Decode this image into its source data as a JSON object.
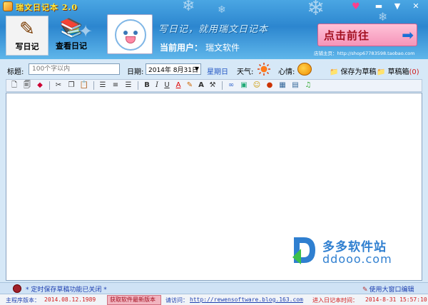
{
  "window": {
    "title": "瑞文日记本 2.0"
  },
  "nav": {
    "write_label": "写日记",
    "view_label": "查看日记"
  },
  "header": {
    "slogan": "写日记，就用瑞文日记本",
    "current_user_label": "当前用户：",
    "current_user": "瑞文软件",
    "banner_text": "点击前往",
    "shop_line": "店铺主页：http://shop67783598.taobao.com"
  },
  "form": {
    "title_label": "标题:",
    "title_placeholder": "100个字以内",
    "date_label": "日期:",
    "date_value": "2014年 8月31日",
    "weekday": "星期日",
    "weather_label": "天气:",
    "mood_label": "心情:",
    "save_draft": "保存为草稿",
    "draft_box": "草稿箱",
    "draft_count": "(0)"
  },
  "toolbar": {
    "buttons": [
      "new-doc-icon",
      "open-doc-icon",
      "eraser-icon",
      "cut-icon",
      "copy-icon",
      "paste-icon",
      "align-left-icon",
      "align-center-icon",
      "align-right-icon",
      "bold-icon",
      "italic-icon",
      "underline-icon",
      "font-color-icon",
      "highlight-icon",
      "font-size-icon",
      "tools-icon",
      "link-icon",
      "image-icon",
      "emoji-icon",
      "flash-icon",
      "table-icon",
      "grid-icon",
      "music-icon"
    ],
    "labels": {
      "bold": "B",
      "italic": "I",
      "underline": "U",
      "fontcolor": "A",
      "fontsize": "A"
    }
  },
  "watermark": {
    "cn": "多多软件站",
    "en": "ddooo.com"
  },
  "status": {
    "autosave": "* 定时保存草稿功能已关闭 *",
    "big_window": "使用大窗口编辑",
    "version_label": "主程序版本：",
    "version": "2014.08.12.1989",
    "get_new": "获取软件最新版本",
    "visit_label": "请访问：",
    "visit_url": "http://rewensoftware.blog.163.com",
    "enter_label": "进入日记本时间：",
    "enter_time": "2014-8-31 15:57:10"
  },
  "colors": {
    "header": "#2c86cf",
    "body": "#d6e8f7",
    "accent_red": "#d21c1c",
    "link_blue": "#1d3fb0"
  }
}
